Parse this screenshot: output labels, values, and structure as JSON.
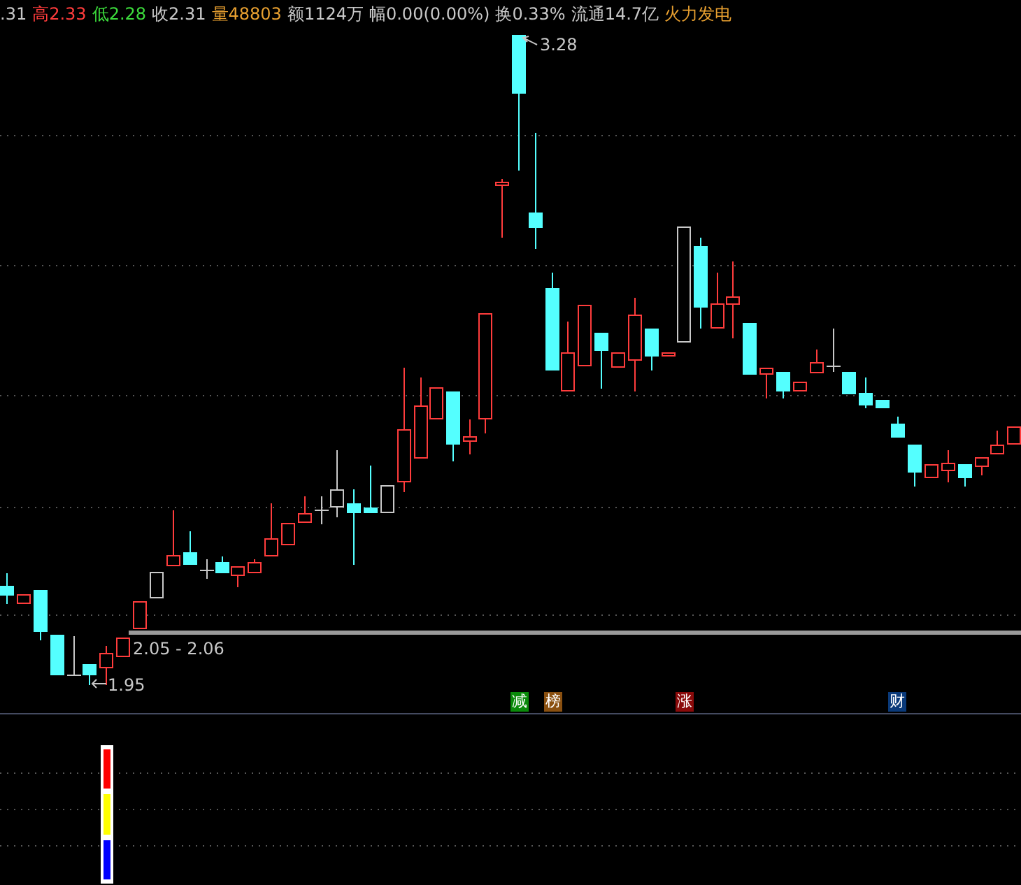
{
  "quote_bar": [
    {
      "text": ".31",
      "color": "#c8c8c8"
    },
    {
      "text": "高2.33",
      "color": "#ff3c3c"
    },
    {
      "text": "低2.28",
      "color": "#3cdc3c"
    },
    {
      "text": "收2.31",
      "color": "#c8c8c8"
    },
    {
      "text": "量48803",
      "color": "#e8a030"
    },
    {
      "text": "额1124万",
      "color": "#c8c8c8"
    },
    {
      "text": "幅0.00(0.00%)",
      "color": "#c8c8c8"
    },
    {
      "text": "换0.33%",
      "color": "#c8c8c8"
    },
    {
      "text": "流通14.7亿",
      "color": "#c8c8c8"
    },
    {
      "text": "火力发电",
      "color": "#e8a030"
    }
  ],
  "chart": {
    "high_label": "3.28",
    "low_label": "1.95",
    "range_label": "2.05 - 2.06"
  },
  "event_markers": [
    {
      "text": "减",
      "color": "#0a8a0a"
    },
    {
      "text": "榜",
      "color": "#8a5010"
    },
    {
      "text": "涨",
      "color": "#8a0a0a"
    },
    {
      "text": "财",
      "color": "#0a3a7a"
    }
  ]
}
